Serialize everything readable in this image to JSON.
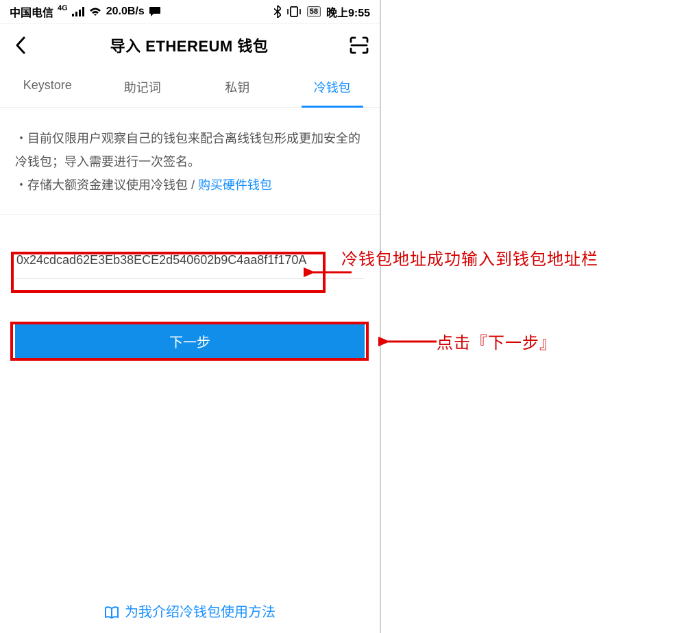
{
  "status": {
    "carrier": "中国电信",
    "speed": "20.0B/s",
    "battery": "58",
    "time": "晚上9:55"
  },
  "nav": {
    "title": "导入 ETHEREUM 钱包"
  },
  "tabs": [
    {
      "label": "Keystore"
    },
    {
      "label": "助记词"
    },
    {
      "label": "私钥"
    },
    {
      "label": "冷钱包",
      "active": true
    }
  ],
  "info": {
    "line1": "・目前仅限用户观察自己的钱包来配合离线钱包形成更加安全的冷钱包；导入需要进行一次签名。",
    "line2_prefix": "・存储大额资金建议使用冷钱包 / ",
    "line2_link": "购买硬件钱包"
  },
  "form": {
    "address": "0x24cdcad62E3Eb38ECE2d540602b9C4aa8f1f170A",
    "next_label": "下一步"
  },
  "bottom_link": "为我介绍冷钱包使用方法",
  "annotations": {
    "a1": "冷钱包地址成功输入到钱包地址栏",
    "a2": "点击『下一步』"
  }
}
